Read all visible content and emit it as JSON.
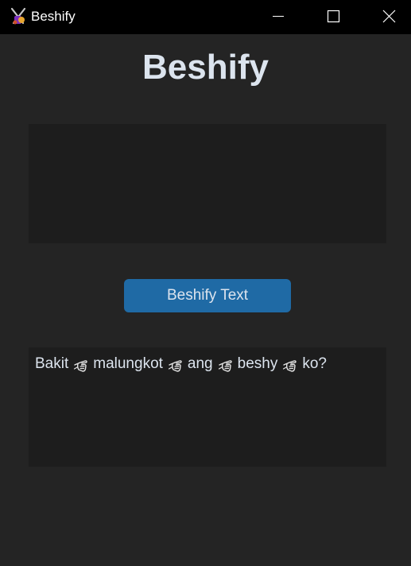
{
  "window": {
    "title": "Beshify",
    "icon": "clapper-icon",
    "controls": {
      "minimize_icon": "minimize-icon",
      "maximize_icon": "maximize-icon",
      "close_icon": "close-icon"
    }
  },
  "main": {
    "heading": "Beshify",
    "input": {
      "value": "",
      "placeholder": ""
    },
    "button_label": "Beshify Text",
    "output": {
      "words": [
        "Bakit",
        "malungkot",
        "ang",
        "beshy",
        "ko?"
      ],
      "separator_icon": "pointing-hand-icon"
    }
  },
  "colors": {
    "background": "#242424",
    "titlebar": "#000000",
    "textbox": "#1d1d1d",
    "button": "#1f6aa5",
    "text": "#dce4ee"
  }
}
